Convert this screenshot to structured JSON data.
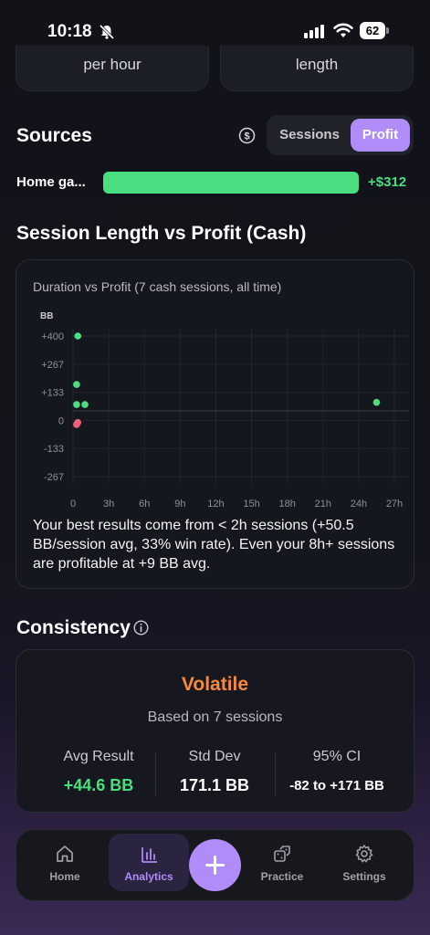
{
  "status_bar": {
    "time": "10:18",
    "battery": "62"
  },
  "top_cards": {
    "left_label": "per hour",
    "right_label": "length"
  },
  "sources": {
    "title": "Sources",
    "toggle": {
      "sessions_label": "Sessions",
      "profit_label": "Profit",
      "selected": "Profit"
    },
    "items": [
      {
        "label": "Home ga...",
        "value": "+$312",
        "bar_fraction": 1.0
      }
    ]
  },
  "session_length": {
    "title": "Session Length vs Profit (Cash)",
    "subtitle": "Duration vs Profit (7 cash sessions, all time)",
    "insight": "Your best results come from < 2h sessions (+50.5 BB/session avg, 33% win rate). Even your 8h+ sessions are profitable at +9 BB avg."
  },
  "chart_data": {
    "type": "scatter",
    "title": "Duration vs Profit (7 cash sessions, all time)",
    "ylabel": "BB",
    "xlabel": "",
    "x_ticks": [
      "0",
      "3h",
      "6h",
      "9h",
      "12h",
      "15h",
      "18h",
      "21h",
      "24h",
      "27h"
    ],
    "y_ticks": [
      "+400",
      "+267",
      "+133",
      "0",
      "-133",
      "-267"
    ],
    "xlim": [
      0,
      27
    ],
    "ylim": [
      -267,
      400
    ],
    "reference_line_y": 44.6,
    "points": [
      {
        "x": 0.4,
        "y": 400,
        "color": "#4ade80"
      },
      {
        "x": 0.3,
        "y": 170,
        "color": "#4ade80"
      },
      {
        "x": 0.3,
        "y": 75,
        "color": "#4ade80"
      },
      {
        "x": 1.0,
        "y": 75,
        "color": "#4ade80"
      },
      {
        "x": 0.4,
        "y": -10,
        "color": "#f0607a"
      },
      {
        "x": 0.3,
        "y": -20,
        "color": "#f0607a"
      },
      {
        "x": 25.5,
        "y": 85,
        "color": "#4ade80"
      }
    ]
  },
  "consistency": {
    "title": "Consistency",
    "verdict": "Volatile",
    "based_on": "Based on 7 sessions",
    "stats": [
      {
        "label": "Avg Result",
        "value": "+44.6 BB",
        "color": "#4ade80"
      },
      {
        "label": "Std Dev",
        "value": "171.1 BB",
        "color": "#ffffff"
      },
      {
        "label": "95% CI",
        "value": "-82 to +171 BB",
        "color": "#ffffff"
      }
    ]
  },
  "nav": {
    "home": "Home",
    "analytics": "Analytics",
    "practice": "Practice",
    "settings": "Settings",
    "active": "Analytics"
  },
  "colors": {
    "accent": "#b08cf8",
    "positive": "#4ade80",
    "negative": "#f0607a",
    "warning": "#f58a3c"
  }
}
